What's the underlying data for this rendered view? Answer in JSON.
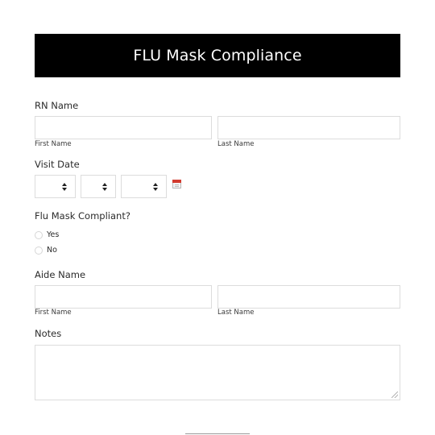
{
  "form": {
    "title": "FLU Mask Compliance",
    "rn_name": {
      "label": "RN Name",
      "first_sublabel": "First Name",
      "last_sublabel": "Last Name",
      "first_value": "",
      "last_value": ""
    },
    "visit_date": {
      "label": "Visit Date",
      "month_value": "",
      "day_value": "",
      "year_value": "",
      "icon": "calendar-icon"
    },
    "mask_compliant": {
      "label": "Flu Mask Compliant?",
      "options": [
        "Yes",
        "No"
      ],
      "selected": null
    },
    "aide_name": {
      "label": "Aide Name",
      "first_sublabel": "First Name",
      "last_sublabel": "Last Name",
      "first_value": "",
      "last_value": ""
    },
    "notes": {
      "label": "Notes",
      "value": ""
    }
  },
  "colors": {
    "header_bg": "#000000",
    "header_text": "#ffffff",
    "border": "#dcdcdc",
    "calendar_accent": "#d23a2e"
  }
}
